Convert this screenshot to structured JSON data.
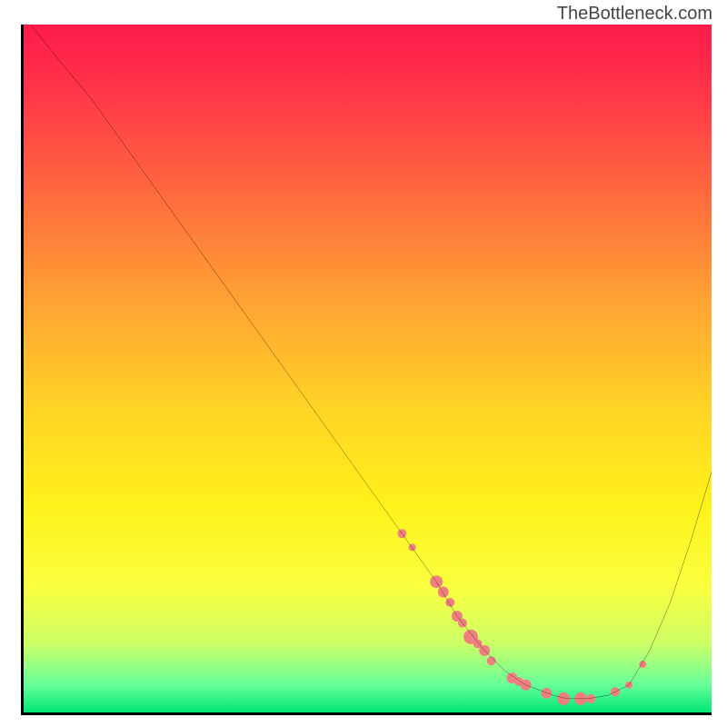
{
  "attribution": "TheBottleneck.com",
  "chart_data": {
    "type": "line",
    "title": "",
    "xlabel": "",
    "ylabel": "",
    "xlim": [
      0,
      100
    ],
    "ylim": [
      0,
      100
    ],
    "curve": {
      "name": "bottleneck-curve",
      "color": "#000000",
      "x": [
        1,
        5,
        10,
        15,
        20,
        25,
        30,
        35,
        40,
        45,
        50,
        55,
        60,
        63,
        67,
        70,
        73,
        77,
        79,
        82,
        85,
        88,
        91,
        94,
        97,
        100
      ],
      "y": [
        100,
        95,
        89,
        82,
        75,
        68,
        61,
        54,
        47,
        40,
        33,
        26,
        19,
        14,
        9,
        6,
        4,
        2.5,
        2,
        2,
        2.5,
        4,
        9,
        16,
        25,
        35
      ]
    },
    "scatter_points": {
      "name": "data-points",
      "color": "#f08080",
      "points": [
        {
          "x": 55,
          "y": 26,
          "r": 5
        },
        {
          "x": 56.5,
          "y": 24,
          "r": 4
        },
        {
          "x": 60,
          "y": 19,
          "r": 7
        },
        {
          "x": 61,
          "y": 17.5,
          "r": 6
        },
        {
          "x": 62,
          "y": 16,
          "r": 5
        },
        {
          "x": 63,
          "y": 14,
          "r": 6
        },
        {
          "x": 63.8,
          "y": 13,
          "r": 5
        },
        {
          "x": 65,
          "y": 11,
          "r": 8
        },
        {
          "x": 66,
          "y": 10,
          "r": 5
        },
        {
          "x": 67,
          "y": 9,
          "r": 6
        },
        {
          "x": 68,
          "y": 7.5,
          "r": 5
        },
        {
          "x": 71,
          "y": 5,
          "r": 6
        },
        {
          "x": 72,
          "y": 4.5,
          "r": 5
        },
        {
          "x": 73,
          "y": 4,
          "r": 6
        },
        {
          "x": 76,
          "y": 2.8,
          "r": 6
        },
        {
          "x": 78.5,
          "y": 2,
          "r": 7
        },
        {
          "x": 81,
          "y": 2,
          "r": 7
        },
        {
          "x": 82.5,
          "y": 2,
          "r": 5
        },
        {
          "x": 86,
          "y": 3,
          "r": 5
        },
        {
          "x": 88,
          "y": 4,
          "r": 4
        },
        {
          "x": 90,
          "y": 7,
          "r": 4
        }
      ]
    },
    "gradient_stops": [
      {
        "offset": 0,
        "color": "#ff1a4a"
      },
      {
        "offset": 0.1,
        "color": "#ff3648"
      },
      {
        "offset": 0.25,
        "color": "#ff6b3e"
      },
      {
        "offset": 0.4,
        "color": "#ffa233"
      },
      {
        "offset": 0.55,
        "color": "#ffd226"
      },
      {
        "offset": 0.7,
        "color": "#fff21a"
      },
      {
        "offset": 0.82,
        "color": "#f9ff40"
      },
      {
        "offset": 0.9,
        "color": "#ccff66"
      },
      {
        "offset": 0.96,
        "color": "#66ff99"
      },
      {
        "offset": 1.0,
        "color": "#00e676"
      }
    ]
  }
}
